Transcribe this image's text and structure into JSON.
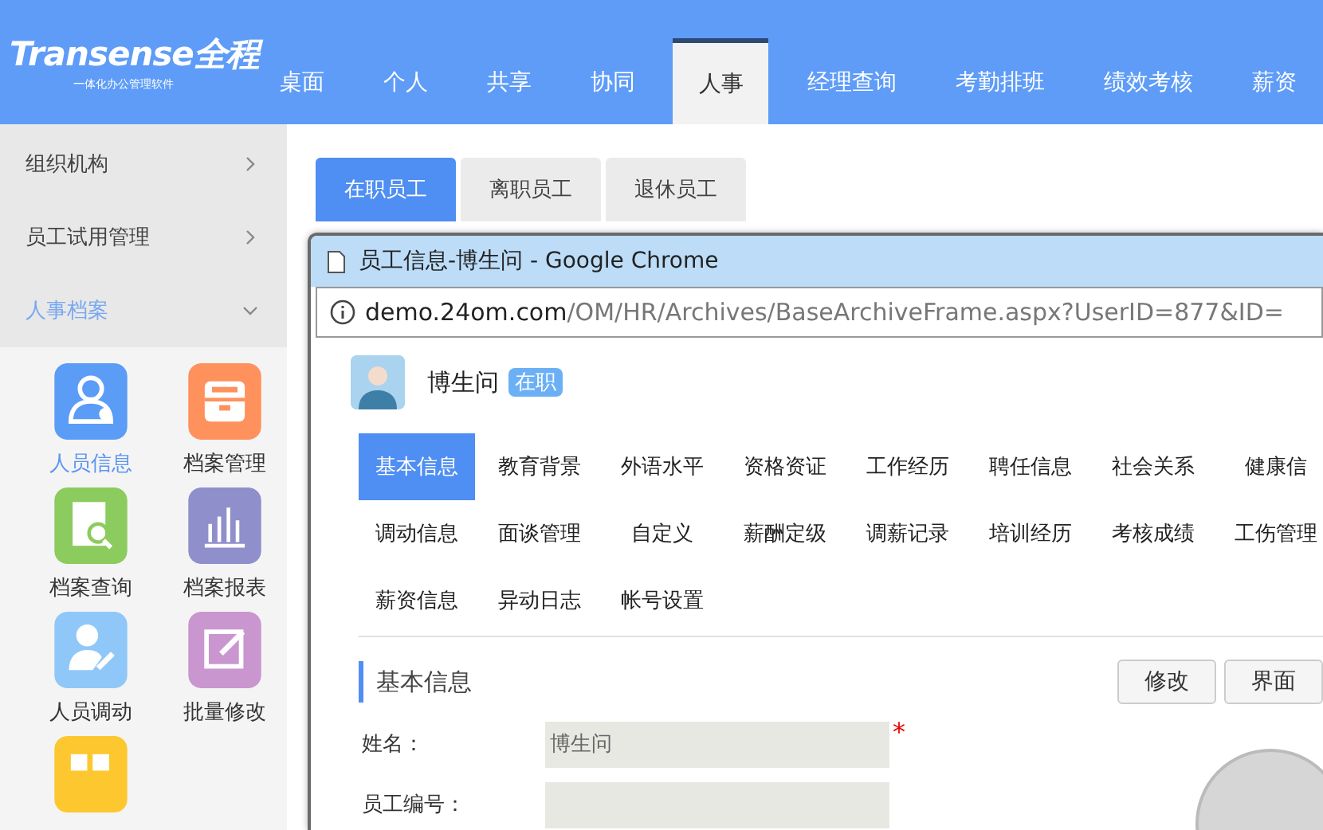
{
  "logo": {
    "name": "Transense全程",
    "tagline": "一体化办公管理软件"
  },
  "nav": [
    {
      "label": "桌面",
      "selected": false
    },
    {
      "label": "个人",
      "selected": false
    },
    {
      "label": "共享",
      "selected": false
    },
    {
      "label": "协同",
      "selected": false
    },
    {
      "label": "人事",
      "selected": true
    },
    {
      "label": "经理查询",
      "selected": false
    },
    {
      "label": "考勤排班",
      "selected": false
    },
    {
      "label": "绩效考核",
      "selected": false
    },
    {
      "label": "薪资",
      "selected": false
    }
  ],
  "sidebar": {
    "menu": [
      {
        "label": "组织机构",
        "expanded": false
      },
      {
        "label": "员工试用管理",
        "expanded": false
      },
      {
        "label": "人事档案",
        "expanded": true
      }
    ],
    "apps": [
      {
        "label": "人员信息",
        "kind": "person",
        "color": "#5b9cf6",
        "selected": true
      },
      {
        "label": "档案管理",
        "kind": "box",
        "color": "#fe915c",
        "selected": false
      },
      {
        "label": "档案查询",
        "kind": "search",
        "color": "#8ccb5e",
        "selected": false
      },
      {
        "label": "档案报表",
        "kind": "chart",
        "color": "#8f8fcb",
        "selected": false
      },
      {
        "label": "人员调动",
        "kind": "edit-person",
        "color": "#8fc8f8",
        "selected": false
      },
      {
        "label": "批量修改",
        "kind": "edit",
        "color": "#c996cf",
        "selected": false
      },
      {
        "kind": "grid",
        "color": "#fdc82f"
      }
    ]
  },
  "tabs": [
    {
      "label": "在职员工",
      "selected": true
    },
    {
      "label": "离职员工",
      "selected": false
    },
    {
      "label": "退休员工",
      "selected": false
    }
  ],
  "popup": {
    "title": "员工信息-博生问 - Google Chrome",
    "url_host": "demo.24om.com",
    "url_path": "/OM/HR/Archives/BaseArchiveFrame.aspx?UserID=877&ID=",
    "employee": {
      "name": "博生问",
      "status": "在职"
    },
    "tabs": [
      {
        "label": "基本信息",
        "selected": true
      },
      {
        "label": "教育背景",
        "selected": false
      },
      {
        "label": "外语水平",
        "selected": false
      },
      {
        "label": "资格资证",
        "selected": false
      },
      {
        "label": "工作经历",
        "selected": false
      },
      {
        "label": "聘任信息",
        "selected": false
      },
      {
        "label": "社会关系",
        "selected": false
      },
      {
        "label": "健康信",
        "selected": false
      },
      {
        "label": "调动信息",
        "selected": false
      },
      {
        "label": "面谈管理",
        "selected": false
      },
      {
        "label": "自定义",
        "selected": false
      },
      {
        "label": "薪酬定级",
        "selected": false
      },
      {
        "label": "调薪记录",
        "selected": false
      },
      {
        "label": "培训经历",
        "selected": false
      },
      {
        "label": "考核成绩",
        "selected": false
      },
      {
        "label": "工伤管理",
        "selected": false
      },
      {
        "label": "薪资信息",
        "selected": false
      },
      {
        "label": "异动日志",
        "selected": false
      },
      {
        "label": "帐号设置",
        "selected": false
      }
    ],
    "section": "基本信息",
    "buttons": [
      "修改",
      "界面"
    ],
    "fields": [
      {
        "label": "姓名：",
        "value": "博生问",
        "required_mark": "*"
      },
      {
        "label": "员工编号："
      }
    ]
  }
}
